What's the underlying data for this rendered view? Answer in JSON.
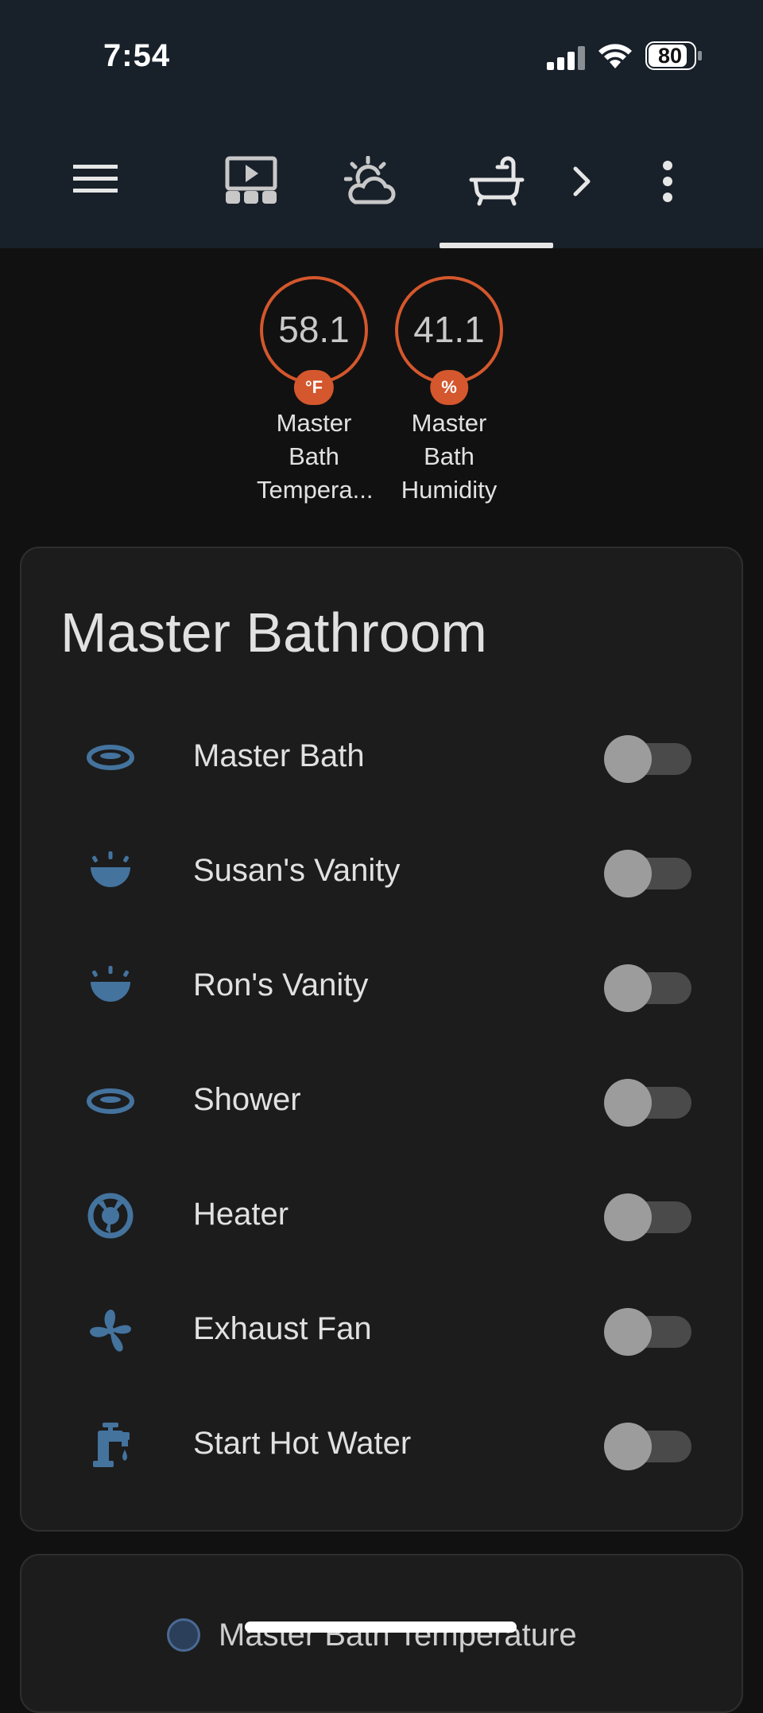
{
  "status_bar": {
    "time": "7:54",
    "battery": "80"
  },
  "toolbar": {
    "menu_icon": "menu-icon",
    "tabs": [
      {
        "icon": "theater-icon",
        "selected": false
      },
      {
        "icon": "weather-partly-cloudy-icon",
        "selected": false
      },
      {
        "icon": "bathtub-icon",
        "selected": true
      }
    ],
    "scroll_icon": "chevron-right-icon",
    "overflow_icon": "dots-vertical-icon"
  },
  "badges": [
    {
      "value": "58.1",
      "unit": "°F",
      "label_lines": [
        "Master",
        "Bath",
        "Tempera..."
      ]
    },
    {
      "value": "41.1",
      "unit": "%",
      "label_lines": [
        "Master",
        "Bath",
        "Humidity"
      ]
    }
  ],
  "card": {
    "title": "Master Bathroom",
    "rows": [
      {
        "label": "Master Bath",
        "icon": "ceiling-light-icon",
        "on": false
      },
      {
        "label": "Susan's Vanity",
        "icon": "vanity-light-icon",
        "on": false
      },
      {
        "label": "Ron's Vanity",
        "icon": "vanity-light-icon",
        "on": false
      },
      {
        "label": "Shower",
        "icon": "ceiling-light-icon",
        "on": false
      },
      {
        "label": "Heater",
        "icon": "heater-icon",
        "on": false
      },
      {
        "label": "Exhaust Fan",
        "icon": "fan-icon",
        "on": false
      },
      {
        "label": "Start Hot Water",
        "icon": "water-pump-icon",
        "on": false
      }
    ]
  },
  "history_card": {
    "legend_label": "Master Bath Temperature"
  },
  "colors": {
    "accent_orange": "#d4572d",
    "icon_blue": "#44739e",
    "header_bg": "#18202a",
    "card_bg": "#1c1c1c",
    "page_bg": "#111111"
  }
}
